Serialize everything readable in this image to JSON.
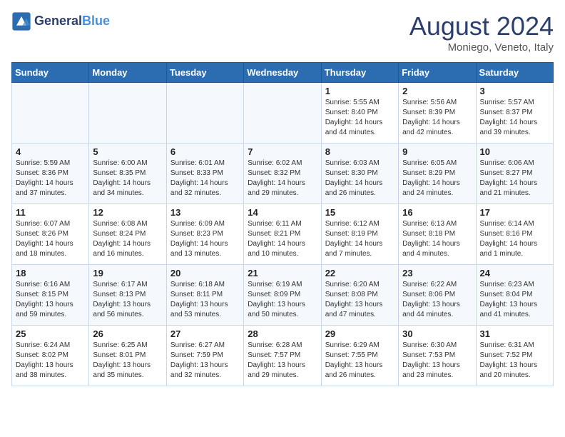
{
  "header": {
    "logo_line1": "General",
    "logo_line2": "Blue",
    "month_year": "August 2024",
    "location": "Moniego, Veneto, Italy"
  },
  "days_of_week": [
    "Sunday",
    "Monday",
    "Tuesday",
    "Wednesday",
    "Thursday",
    "Friday",
    "Saturday"
  ],
  "weeks": [
    [
      {
        "day": "",
        "info": ""
      },
      {
        "day": "",
        "info": ""
      },
      {
        "day": "",
        "info": ""
      },
      {
        "day": "",
        "info": ""
      },
      {
        "day": "1",
        "info": "Sunrise: 5:55 AM\nSunset: 8:40 PM\nDaylight: 14 hours\nand 44 minutes."
      },
      {
        "day": "2",
        "info": "Sunrise: 5:56 AM\nSunset: 8:39 PM\nDaylight: 14 hours\nand 42 minutes."
      },
      {
        "day": "3",
        "info": "Sunrise: 5:57 AM\nSunset: 8:37 PM\nDaylight: 14 hours\nand 39 minutes."
      }
    ],
    [
      {
        "day": "4",
        "info": "Sunrise: 5:59 AM\nSunset: 8:36 PM\nDaylight: 14 hours\nand 37 minutes."
      },
      {
        "day": "5",
        "info": "Sunrise: 6:00 AM\nSunset: 8:35 PM\nDaylight: 14 hours\nand 34 minutes."
      },
      {
        "day": "6",
        "info": "Sunrise: 6:01 AM\nSunset: 8:33 PM\nDaylight: 14 hours\nand 32 minutes."
      },
      {
        "day": "7",
        "info": "Sunrise: 6:02 AM\nSunset: 8:32 PM\nDaylight: 14 hours\nand 29 minutes."
      },
      {
        "day": "8",
        "info": "Sunrise: 6:03 AM\nSunset: 8:30 PM\nDaylight: 14 hours\nand 26 minutes."
      },
      {
        "day": "9",
        "info": "Sunrise: 6:05 AM\nSunset: 8:29 PM\nDaylight: 14 hours\nand 24 minutes."
      },
      {
        "day": "10",
        "info": "Sunrise: 6:06 AM\nSunset: 8:27 PM\nDaylight: 14 hours\nand 21 minutes."
      }
    ],
    [
      {
        "day": "11",
        "info": "Sunrise: 6:07 AM\nSunset: 8:26 PM\nDaylight: 14 hours\nand 18 minutes."
      },
      {
        "day": "12",
        "info": "Sunrise: 6:08 AM\nSunset: 8:24 PM\nDaylight: 14 hours\nand 16 minutes."
      },
      {
        "day": "13",
        "info": "Sunrise: 6:09 AM\nSunset: 8:23 PM\nDaylight: 14 hours\nand 13 minutes."
      },
      {
        "day": "14",
        "info": "Sunrise: 6:11 AM\nSunset: 8:21 PM\nDaylight: 14 hours\nand 10 minutes."
      },
      {
        "day": "15",
        "info": "Sunrise: 6:12 AM\nSunset: 8:19 PM\nDaylight: 14 hours\nand 7 minutes."
      },
      {
        "day": "16",
        "info": "Sunrise: 6:13 AM\nSunset: 8:18 PM\nDaylight: 14 hours\nand 4 minutes."
      },
      {
        "day": "17",
        "info": "Sunrise: 6:14 AM\nSunset: 8:16 PM\nDaylight: 14 hours\nand 1 minute."
      }
    ],
    [
      {
        "day": "18",
        "info": "Sunrise: 6:16 AM\nSunset: 8:15 PM\nDaylight: 13 hours\nand 59 minutes."
      },
      {
        "day": "19",
        "info": "Sunrise: 6:17 AM\nSunset: 8:13 PM\nDaylight: 13 hours\nand 56 minutes."
      },
      {
        "day": "20",
        "info": "Sunrise: 6:18 AM\nSunset: 8:11 PM\nDaylight: 13 hours\nand 53 minutes."
      },
      {
        "day": "21",
        "info": "Sunrise: 6:19 AM\nSunset: 8:09 PM\nDaylight: 13 hours\nand 50 minutes."
      },
      {
        "day": "22",
        "info": "Sunrise: 6:20 AM\nSunset: 8:08 PM\nDaylight: 13 hours\nand 47 minutes."
      },
      {
        "day": "23",
        "info": "Sunrise: 6:22 AM\nSunset: 8:06 PM\nDaylight: 13 hours\nand 44 minutes."
      },
      {
        "day": "24",
        "info": "Sunrise: 6:23 AM\nSunset: 8:04 PM\nDaylight: 13 hours\nand 41 minutes."
      }
    ],
    [
      {
        "day": "25",
        "info": "Sunrise: 6:24 AM\nSunset: 8:02 PM\nDaylight: 13 hours\nand 38 minutes."
      },
      {
        "day": "26",
        "info": "Sunrise: 6:25 AM\nSunset: 8:01 PM\nDaylight: 13 hours\nand 35 minutes."
      },
      {
        "day": "27",
        "info": "Sunrise: 6:27 AM\nSunset: 7:59 PM\nDaylight: 13 hours\nand 32 minutes."
      },
      {
        "day": "28",
        "info": "Sunrise: 6:28 AM\nSunset: 7:57 PM\nDaylight: 13 hours\nand 29 minutes."
      },
      {
        "day": "29",
        "info": "Sunrise: 6:29 AM\nSunset: 7:55 PM\nDaylight: 13 hours\nand 26 minutes."
      },
      {
        "day": "30",
        "info": "Sunrise: 6:30 AM\nSunset: 7:53 PM\nDaylight: 13 hours\nand 23 minutes."
      },
      {
        "day": "31",
        "info": "Sunrise: 6:31 AM\nSunset: 7:52 PM\nDaylight: 13 hours\nand 20 minutes."
      }
    ]
  ]
}
